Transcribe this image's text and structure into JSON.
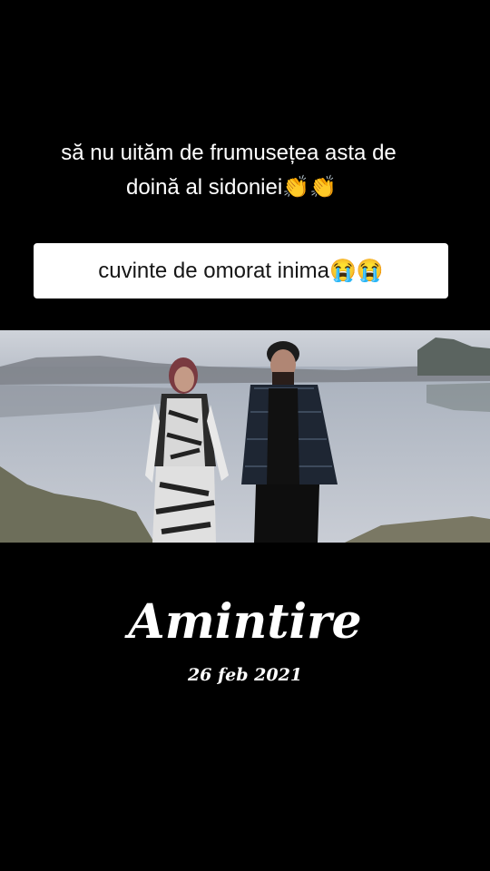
{
  "caption": {
    "line1": "să nu uităm de frumusețea asta de",
    "line2": "doină al sidoniei👏👏"
  },
  "comment": {
    "text": "cuvinte de omorat inima😭😭"
  },
  "video": {
    "icon": "music-video-frame"
  },
  "overlay": {
    "title": "Amintire",
    "date": "26 feb 2021"
  }
}
